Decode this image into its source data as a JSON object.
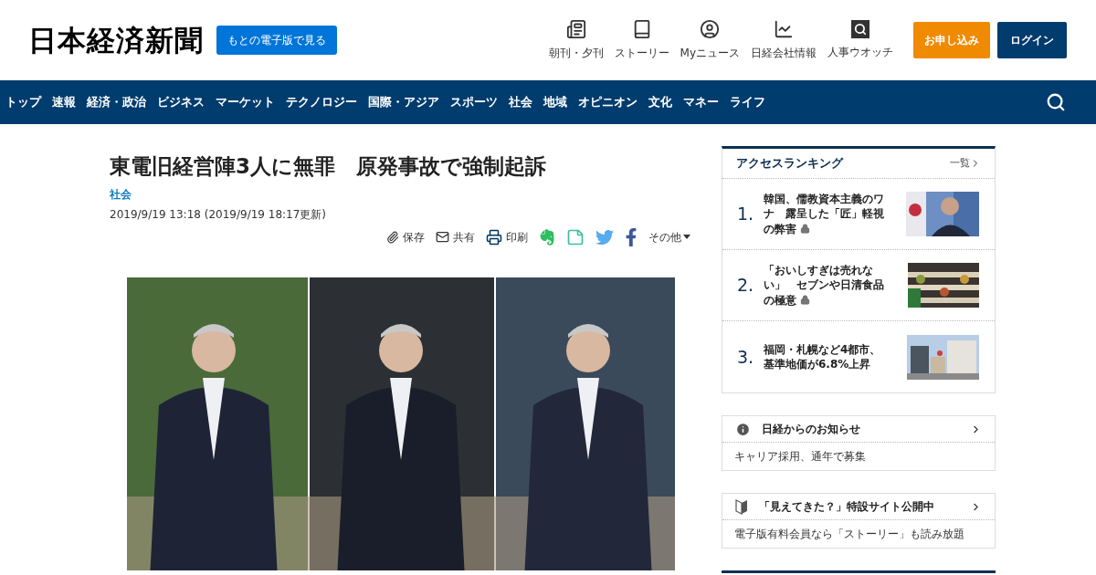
{
  "header": {
    "logo": "日本経済新聞",
    "edition_button": "もとの電子版で見る",
    "links": [
      {
        "kind": "newspaper",
        "label": "朝刊・夕刊"
      },
      {
        "kind": "story",
        "label": "ストーリー"
      },
      {
        "kind": "mynews",
        "label": "Myニュース"
      },
      {
        "kind": "company",
        "label": "日経会社情報"
      },
      {
        "kind": "jinji",
        "label": "人事ウオッチ"
      }
    ],
    "subscribe_button": "お申し込み",
    "login_button": "ログイン"
  },
  "nav": {
    "items": [
      "トップ",
      "速報",
      "経済・政治",
      "ビジネス",
      "マーケット",
      "テクノロジー",
      "国際・アジア",
      "スポーツ",
      "社会",
      "地域",
      "オピニオン",
      "文化",
      "マネー",
      "ライフ"
    ]
  },
  "article": {
    "title": "東電旧経営陣3人に無罪　原発事故で強制起訴",
    "category": "社会",
    "date": "2019/9/19 13:18 (2019/9/19 18:17更新)",
    "share": [
      {
        "kind": "save",
        "label": "保存"
      },
      {
        "kind": "mail",
        "label": "共有"
      },
      {
        "kind": "print",
        "label": "印刷"
      },
      {
        "kind": "evernote"
      },
      {
        "kind": "memo"
      },
      {
        "kind": "twitter"
      },
      {
        "kind": "facebook"
      },
      {
        "kind": "more",
        "label": "その他"
      }
    ]
  },
  "ranking": {
    "title": "アクセスランキング",
    "more": "一覧",
    "items": [
      {
        "rank": "1.",
        "title": "韓国、儒教資本主義のワナ　露呈した「匠」軽視の弊害",
        "locked": true
      },
      {
        "rank": "2.",
        "title": "「おいしすぎは売れない」　セブンや日清食品の極意",
        "locked": true
      },
      {
        "rank": "3.",
        "title": "福岡・札幌など4都市、基準地価が6.8%上昇",
        "locked": false
      }
    ]
  },
  "notices": [
    {
      "kind": "info",
      "title": "日経からのお知らせ",
      "text": "キャリア採用、通年で募集"
    },
    {
      "kind": "beginner",
      "title": "「見えてきた？」特設サイト公開中",
      "text": "電子版有料会員なら「ストーリー」も読み放題"
    }
  ]
}
